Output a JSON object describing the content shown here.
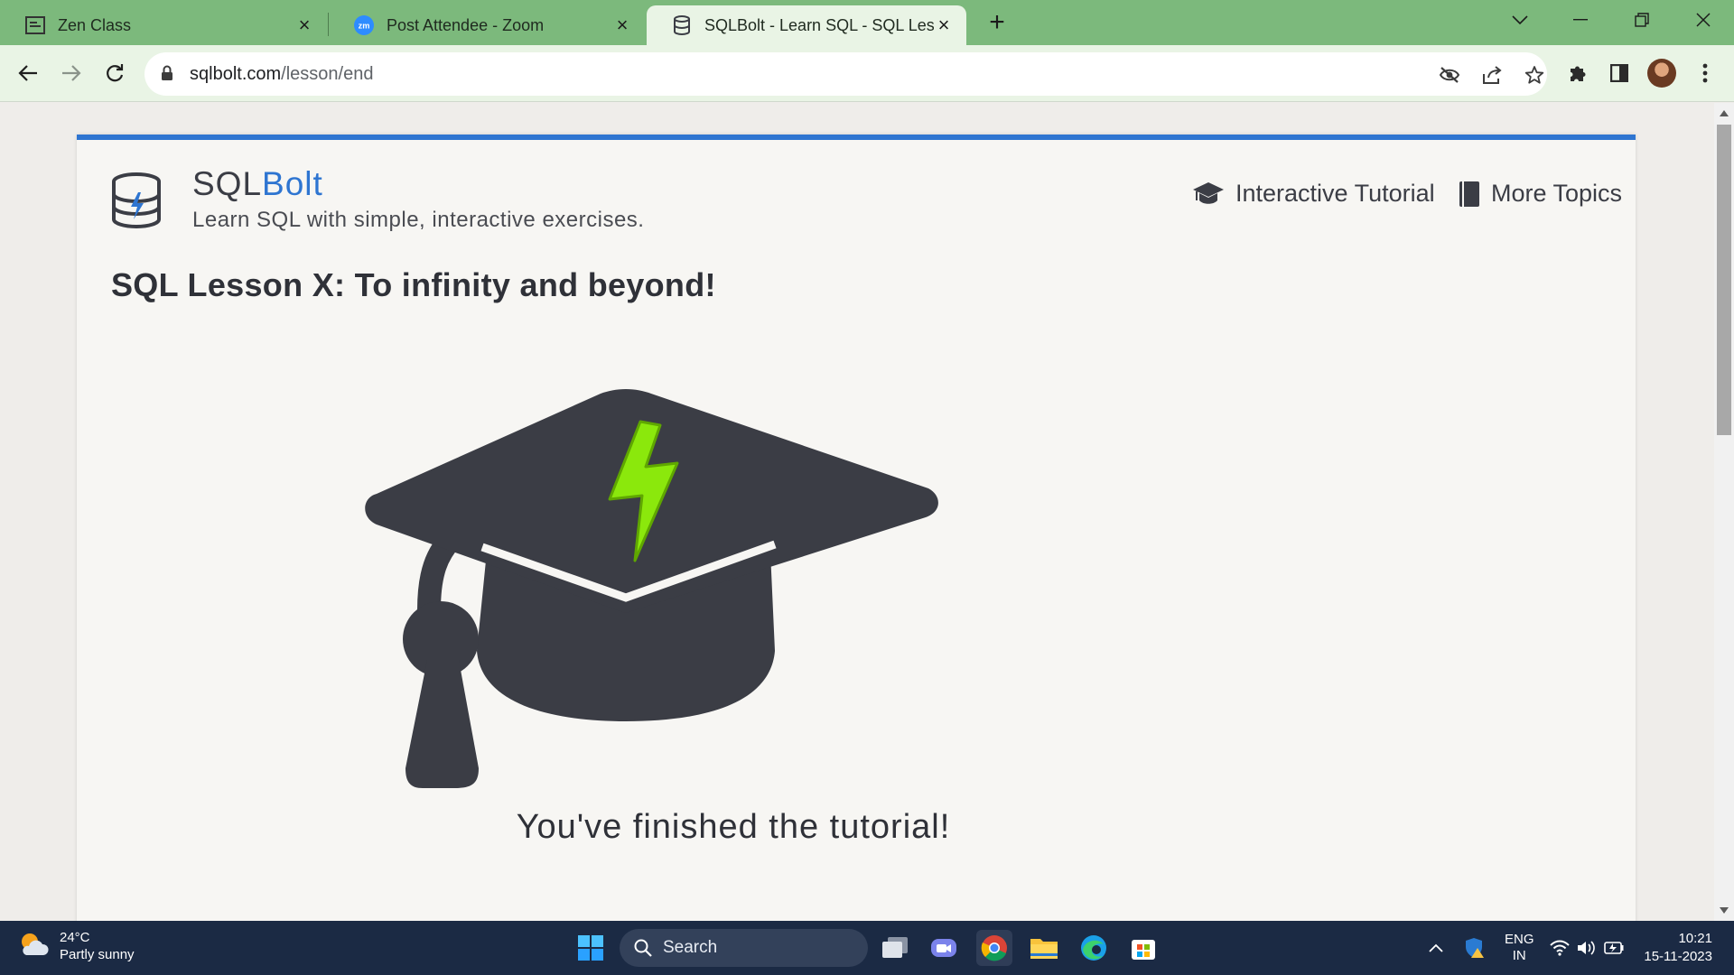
{
  "browser": {
    "tabs": [
      {
        "title": "Zen Class",
        "icon": "zen-class-favicon"
      },
      {
        "title": "Post Attendee - Zoom",
        "icon": "zoom-favicon"
      },
      {
        "title": "SQLBolt - Learn SQL - SQL Lesson X: To infinity and beyond!",
        "icon": "sqlbolt-favicon",
        "active": true
      }
    ],
    "url_host": "sqlbolt.com",
    "url_path": "/lesson/end",
    "theme_color": "#7cb97c"
  },
  "page": {
    "brand_prefix": "SQL",
    "brand_suffix": "Bolt",
    "tagline": "Learn SQL with simple, interactive exercises.",
    "nav": {
      "tutorial": "Interactive Tutorial",
      "topics": "More Topics"
    },
    "lesson_title": "SQL Lesson X: To infinity and beyond!",
    "finished_message": "You've finished the tutorial!",
    "accent_color": "#2e75d1"
  },
  "taskbar": {
    "weather_temp": "24°C",
    "weather_desc": "Partly sunny",
    "search_label": "Search",
    "lang": "ENG",
    "region": "IN",
    "time": "10:21",
    "date": "15-11-2023"
  }
}
